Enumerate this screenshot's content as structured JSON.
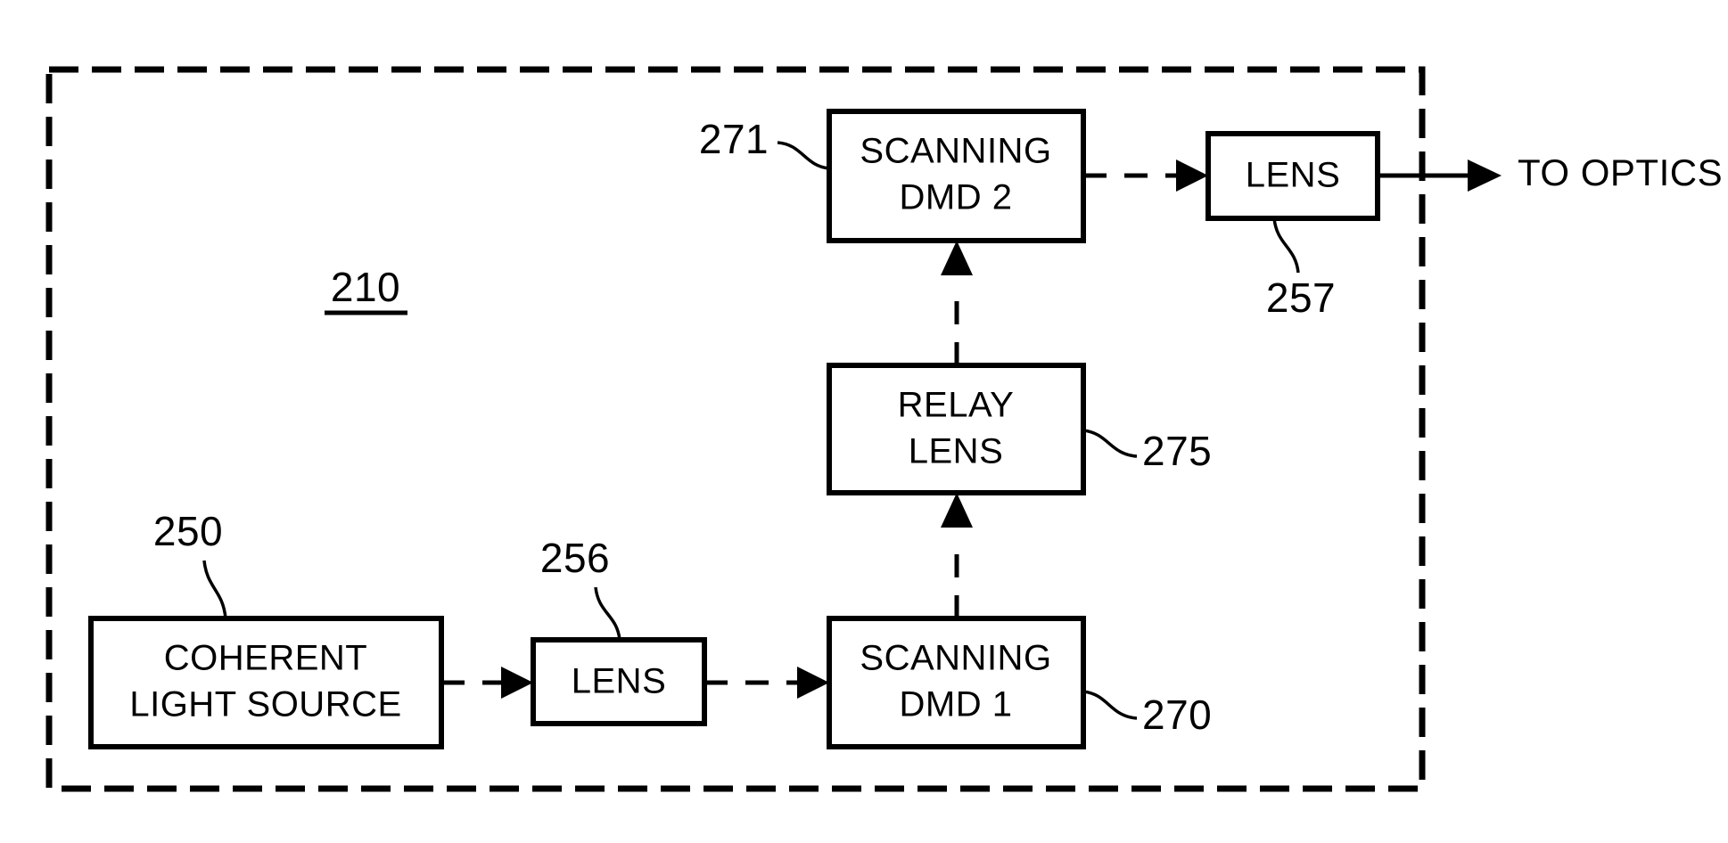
{
  "figure": {
    "enclosure_label": "210",
    "boxes": [
      {
        "id": "coherent_light_source",
        "line1": "COHERENT",
        "line2": "LIGHT SOURCE",
        "ref": "250"
      },
      {
        "id": "lens_256",
        "line1": "LENS",
        "line2": "",
        "ref": "256"
      },
      {
        "id": "scanning_dmd_1",
        "line1": "SCANNING",
        "line2": "DMD 1",
        "ref": "270"
      },
      {
        "id": "relay_lens",
        "line1": "RELAY",
        "line2": "LENS",
        "ref": "275"
      },
      {
        "id": "scanning_dmd_2",
        "line1": "SCANNING",
        "line2": "DMD 2",
        "ref": "271"
      },
      {
        "id": "lens_257",
        "line1": "LENS",
        "line2": "",
        "ref": "257"
      }
    ],
    "output_label": "TO OPTICS",
    "colors": {
      "ink": "#000000",
      "paper": "#ffffff"
    }
  }
}
